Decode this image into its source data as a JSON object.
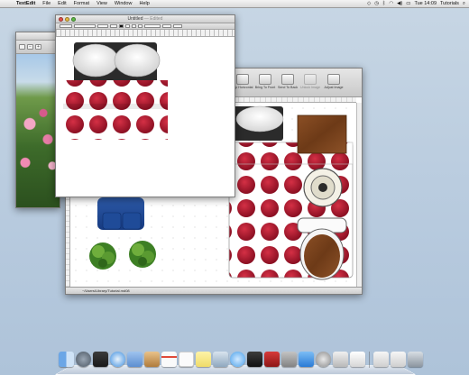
{
  "menubar": {
    "app": "TextEdit",
    "items": [
      "File",
      "Edit",
      "Format",
      "View",
      "Window",
      "Help"
    ],
    "clock": "Tue 14:09",
    "user": "Tutorials"
  },
  "textedit": {
    "title": "Untitled",
    "subtitle": "— Edited"
  },
  "graffle": {
    "toolbar": [
      "Flip Horizontal",
      "Bring To Front",
      "Send To Back",
      "Unlock Image",
      "Adjust Image"
    ],
    "status_path": "~/Users/Library/Tutorial.md08"
  },
  "dock": {
    "icons": [
      "finder-icon",
      "rocket-icon",
      "photo-booth-icon",
      "safari-icon",
      "mail-icon",
      "contacts-icon",
      "calendar-icon",
      "reminders-icon",
      "notes-icon",
      "preview-icon",
      "messages-icon",
      "facetime-icon",
      "itunes-icon",
      "iphoto-icon",
      "app-store-icon",
      "system-preferences-icon",
      "omnigraffle-icon",
      "textedit-icon",
      "stacks-icon",
      "documents-icon",
      "trash-icon"
    ]
  }
}
